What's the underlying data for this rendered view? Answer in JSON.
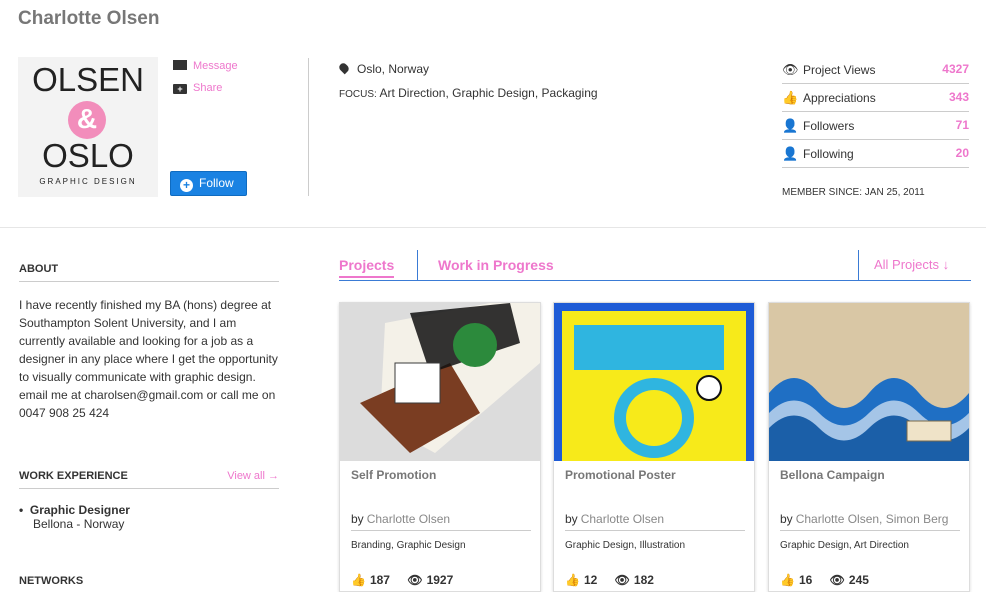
{
  "profile": {
    "name": "Charlotte Olsen",
    "logo": {
      "line1": "OLSEN",
      "amp": "&",
      "line2": "OSLO",
      "tagline": "GRAPHIC DESIGN"
    },
    "actions": {
      "message": "Message",
      "share": "Share"
    },
    "follow_label": "Follow",
    "location": "Oslo, Norway",
    "focus_label": "FOCUS:",
    "focus_value": "Art Direction, Graphic Design, Packaging",
    "member_since": "MEMBER SINCE: JAN 25, 2011"
  },
  "stats": [
    {
      "label": "Project Views",
      "value": "4327",
      "icon": "eye-icon"
    },
    {
      "label": "Appreciations",
      "value": "343",
      "icon": "thumbs-up-icon"
    },
    {
      "label": "Followers",
      "value": "71",
      "icon": "user-icon"
    },
    {
      "label": "Following",
      "value": "20",
      "icon": "user-icon"
    }
  ],
  "sidebar": {
    "about_heading": "ABOUT",
    "about_text": "I have recently finished my BA (hons) degree at Southampton Solent University, and I am currently available and looking for a job as a designer in any place where I get the opportunity to visually communicate with graphic design. email me at charolsen@gmail.com or call me on 0047 908 25 424",
    "work_heading": "WORK EXPERIENCE",
    "view_all": "View all →",
    "job_title": "Graphic Designer",
    "job_company": "Bellona - Norway",
    "networks_heading": "NETWORKS"
  },
  "tabs": {
    "projects": "Projects",
    "wip": "Work in Progress",
    "all_projects": "All Projects ↓"
  },
  "cards": [
    {
      "title": "Self Promotion",
      "by": "by",
      "author": "Charlotte Olsen",
      "fields": "Branding, Graphic Design",
      "likes": "187",
      "views": "1927"
    },
    {
      "title": "Promotional Poster",
      "by": "by",
      "author": "Charlotte Olsen",
      "fields": "Graphic Design, Illustration",
      "likes": "12",
      "views": "182"
    },
    {
      "title": "Bellona Campaign",
      "by": "by",
      "author": "Charlotte Olsen, Simon Berg",
      "fields": "Graphic Design, Art Direction",
      "likes": "16",
      "views": "245"
    }
  ],
  "colors": {
    "accent": "#ee77cc",
    "link_blue": "#3a7bd5",
    "button_blue": "#1a82e2"
  }
}
